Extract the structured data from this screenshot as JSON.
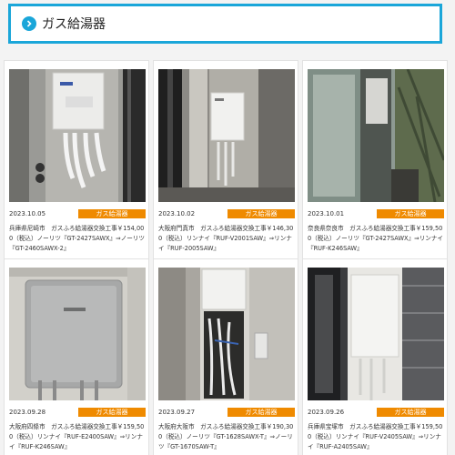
{
  "header": {
    "title": "ガス給湯器",
    "icon": "circle-chevron-right-icon",
    "accent_color": "#1aa6d9"
  },
  "badge_color": "#ef8a00",
  "cards": [
    {
      "date": "2023.10.05",
      "category": "ガス給湯器",
      "description": "兵庫県尼崎市　ガスふろ給湯器交換工事￥154,000（税込）ノーリツ『GT-2427SAWX』⇒ノーリツ『GT-2460SAWX-2』"
    },
    {
      "date": "2023.10.02",
      "category": "ガス給湯器",
      "description": "大阪府門真市　ガスふろ給湯器交換工事￥146,300（税込）リンナイ『RUF-V2001SAW』⇒リンナイ『RUF-2005SAW』"
    },
    {
      "date": "2023.10.01",
      "category": "ガス給湯器",
      "description": "奈良県奈良市　ガスふろ給湯器交換工事￥159,500（税込）ノーリツ『GT-2427SAWX』⇒リンナイ『RUF-K246SAW』"
    },
    {
      "date": "2023.09.28",
      "category": "ガス給湯器",
      "description": "大阪府四條市　ガスふろ給湯器交換工事￥159,500（税込）リンナイ『RUF-E2400SAW』⇒リンナイ『RUF-K246SAW』"
    },
    {
      "date": "2023.09.27",
      "category": "ガス給湯器",
      "description": "大阪府大阪市　ガスふろ給湯器交換工事￥190,300（税込）ノーリツ『GT-1628SAWX-T』⇒ノーリツ『GT-1670SAW-T』"
    },
    {
      "date": "2023.09.26",
      "category": "ガス給湯器",
      "description": "兵庫県宝塚市　ガスふろ給湯器交換工事￥159,500（税込）リンナイ『RUF-V2405SAW』⇒リンナイ『RUF-A2405SAW』"
    }
  ]
}
